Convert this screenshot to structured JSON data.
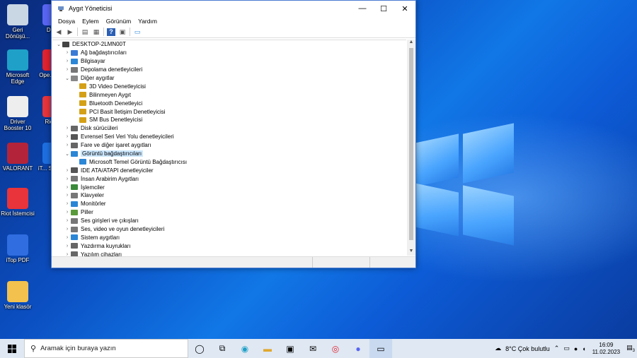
{
  "window": {
    "title": "Aygıt Yöneticisi",
    "menu": [
      "Dosya",
      "Eylem",
      "Görünüm",
      "Yardım"
    ],
    "tree": [
      {
        "label": "DESKTOP-2LMN00T",
        "depth": 0,
        "exp": "v",
        "color": "#444"
      },
      {
        "label": "Ağ bağdaştırıcıları",
        "depth": 1,
        "exp": ">",
        "color": "#3a7bd5"
      },
      {
        "label": "Bilgisayar",
        "depth": 1,
        "exp": ">",
        "color": "#2b86d6"
      },
      {
        "label": "Depolama denetleyicileri",
        "depth": 1,
        "exp": ">",
        "color": "#777"
      },
      {
        "label": "Diğer aygıtlar",
        "depth": 1,
        "exp": "v",
        "color": "#888"
      },
      {
        "label": "3D Video Denetleyicisi",
        "depth": 2,
        "exp": "",
        "color": "#d4a017"
      },
      {
        "label": "Bilinmeyen Aygıt",
        "depth": 2,
        "exp": "",
        "color": "#d4a017"
      },
      {
        "label": "Bluetooth Denetleyici",
        "depth": 2,
        "exp": "",
        "color": "#d4a017"
      },
      {
        "label": "PCI Basit İletişim Denetleyicisi",
        "depth": 2,
        "exp": "",
        "color": "#d4a017"
      },
      {
        "label": "SM Bus Denetleyicisi",
        "depth": 2,
        "exp": "",
        "color": "#d4a017"
      },
      {
        "label": "Disk sürücüleri",
        "depth": 1,
        "exp": ">",
        "color": "#666"
      },
      {
        "label": "Evrensel Seri Veri Yolu denetleyicileri",
        "depth": 1,
        "exp": ">",
        "color": "#555"
      },
      {
        "label": "Fare ve diğer işaret aygıtları",
        "depth": 1,
        "exp": ">",
        "color": "#666"
      },
      {
        "label": "Görüntü bağdaştırıcıları",
        "depth": 1,
        "exp": "v",
        "color": "#2b86d6",
        "selected": true
      },
      {
        "label": "Microsoft Temel Görüntü Bağdaştırıcısı",
        "depth": 2,
        "exp": "",
        "color": "#2b86d6"
      },
      {
        "label": "IDE ATA/ATAPI denetleyiciler",
        "depth": 1,
        "exp": ">",
        "color": "#555"
      },
      {
        "label": "İnsan Arabirim Aygıtları",
        "depth": 1,
        "exp": ">",
        "color": "#777"
      },
      {
        "label": "İşlemciler",
        "depth": 1,
        "exp": ">",
        "color": "#3a8a3a"
      },
      {
        "label": "Klavyeler",
        "depth": 1,
        "exp": ">",
        "color": "#777"
      },
      {
        "label": "Monitörler",
        "depth": 1,
        "exp": ">",
        "color": "#2b86d6"
      },
      {
        "label": "Piller",
        "depth": 1,
        "exp": ">",
        "color": "#5a9a3a"
      },
      {
        "label": "Ses girişleri ve çıkışları",
        "depth": 1,
        "exp": ">",
        "color": "#777"
      },
      {
        "label": "Ses, video ve oyun denetleyicileri",
        "depth": 1,
        "exp": ">",
        "color": "#777"
      },
      {
        "label": "Sistem aygıtları",
        "depth": 1,
        "exp": ">",
        "color": "#2b86d6"
      },
      {
        "label": "Yazdırma kuyrukları",
        "depth": 1,
        "exp": ">",
        "color": "#666"
      },
      {
        "label": "Yazılım cihazları",
        "depth": 1,
        "exp": ">",
        "color": "#666"
      }
    ]
  },
  "desktop": {
    "icons": [
      {
        "label": "Geri Dönüşü...",
        "color": "#c9d6e3"
      },
      {
        "label": "Microsoft Edge",
        "color": "#1fa0c8"
      },
      {
        "label": "Driver Booster 10",
        "color": "#eeeeee"
      },
      {
        "label": "VALORANT",
        "color": "#b3243a"
      },
      {
        "label": "Riot İstemcisi",
        "color": "#e8343a"
      },
      {
        "label": "iTop PDF",
        "color": "#2f6de0"
      },
      {
        "label": "Yeni klasör",
        "color": "#f2c14e"
      }
    ],
    "icons2": [
      {
        "label": "Dis...",
        "color": "#5865f2"
      },
      {
        "label": "Ope... tar...",
        "color": "#e0222f"
      },
      {
        "label": "Riot ...",
        "color": "#e8343a"
      },
      {
        "label": "iT... Scree...",
        "color": "#1d6fe0"
      }
    ]
  },
  "taskbar": {
    "search_placeholder": "Aramak için buraya yazın",
    "weather": "8°C  Çok bulutlu",
    "time": "16:09",
    "date": "11.02.2023",
    "notif_count": "3"
  }
}
